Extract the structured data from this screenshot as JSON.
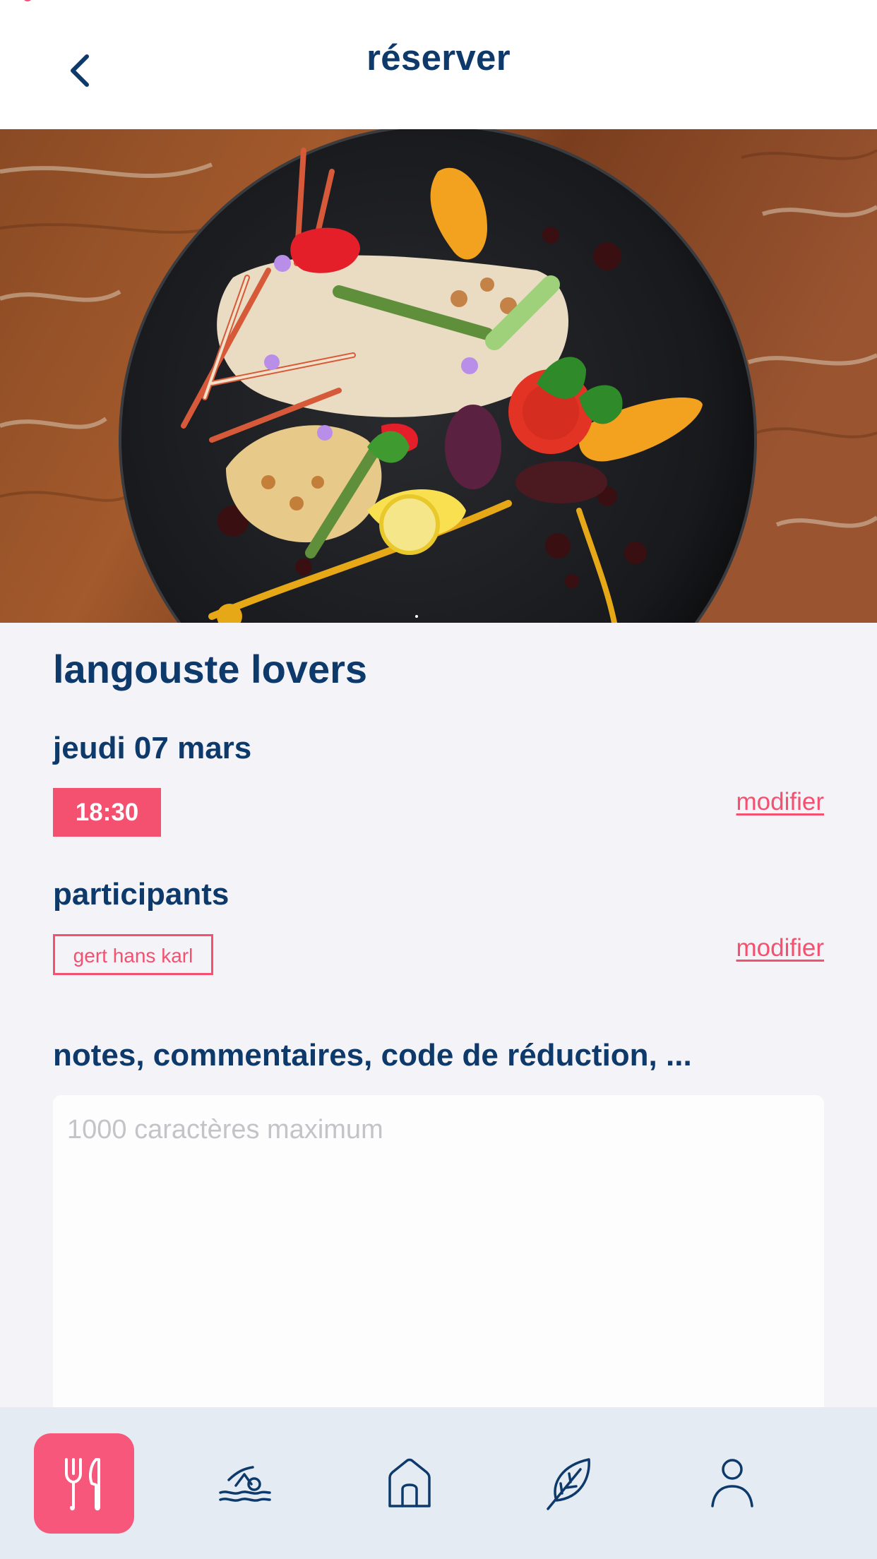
{
  "header": {
    "title": "réserver",
    "back_icon": "chevron-left-icon"
  },
  "event": {
    "title": "langouste lovers",
    "image": "grilled-langouste-dish-photo"
  },
  "booking": {
    "date": "jeudi 07 mars",
    "time": "18:30",
    "modify_time_label": "modifier"
  },
  "participants": {
    "label": "participants",
    "names": [
      "gert hans karl"
    ],
    "modify_label": "modifier"
  },
  "notes": {
    "label": "notes, commentaires, code de réduction, ...",
    "placeholder": "1000 caractères maximum",
    "value": ""
  },
  "tabbar": {
    "items": [
      {
        "icon": "fork-knife-icon",
        "active": true
      },
      {
        "icon": "swimmer-icon",
        "active": false
      },
      {
        "icon": "house-icon",
        "active": false
      },
      {
        "icon": "leaf-icon",
        "active": false
      },
      {
        "icon": "person-icon",
        "active": false
      }
    ]
  },
  "colors": {
    "primary": "#0d3a6b",
    "accent": "#f4506f",
    "background": "#f4f3f8",
    "tabbar": "#e4ebf3"
  }
}
